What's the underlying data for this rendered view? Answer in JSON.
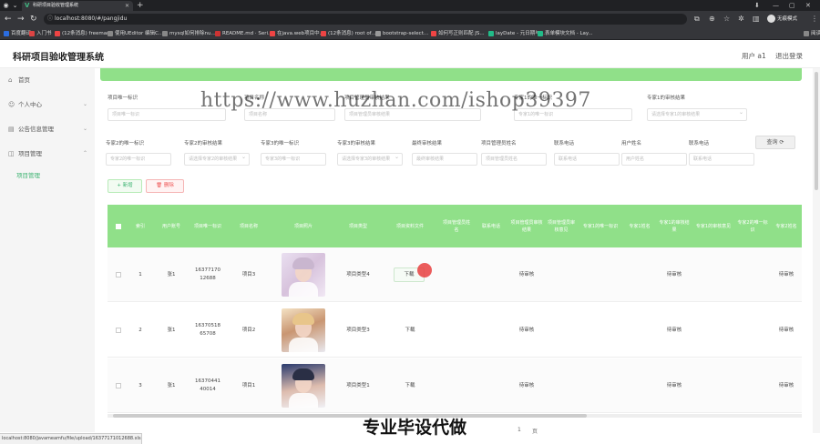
{
  "browser": {
    "tab_title": "科研项目验收管理系统",
    "address": "localhost:8080/#/pangjidu",
    "profile_label": "无痕模式",
    "bookmarks": [
      {
        "label": "百度翻译",
        "color": "#2b6de0"
      },
      {
        "label": "入门书",
        "color": "#d44"
      },
      {
        "label": "(12条消息) freemar...",
        "color": "#e44"
      },
      {
        "label": "使用UEditor 编辑C...",
        "color": "#888"
      },
      {
        "label": "mysql如何排除nu...",
        "color": "#888"
      },
      {
        "label": "README.md · Seri...",
        "color": "#c33"
      },
      {
        "label": "在java.web项目中...",
        "color": "#e44"
      },
      {
        "label": "(12条消息) root of...",
        "color": "#e44"
      },
      {
        "label": "bootstrap-select...",
        "color": "#999"
      },
      {
        "label": "如何写正则匹配 JS...",
        "color": "#e44"
      },
      {
        "label": "layDate - 元日期与...",
        "color": "#2b8"
      },
      {
        "label": "表单模块文档 - Lay...",
        "color": "#2b8"
      },
      {
        "label": "阅读清单",
        "color": "#888"
      }
    ],
    "status_url": "localhost:8080/javameamfu/file/upload/16377171012688.xls"
  },
  "app": {
    "title": "科研项目验收管理系统",
    "user_label": "用户 a1",
    "logout_label": "退出登录",
    "accent_color": "#90e089"
  },
  "sidebar": {
    "items": [
      {
        "label": "首页",
        "icon": "home-icon",
        "glyph": "⌂"
      },
      {
        "label": "个人中心",
        "icon": "user-icon",
        "glyph": "☺"
      },
      {
        "label": "公告信息管理",
        "icon": "notice-icon",
        "glyph": "▤"
      },
      {
        "label": "项目管理",
        "icon": "project-icon",
        "glyph": "◫"
      }
    ],
    "active_sub": "项目管理"
  },
  "filters": {
    "row1": [
      {
        "label": "项目唯一标识",
        "placeholder": "项目唯一标识"
      },
      {
        "label": "项目名称",
        "placeholder": "项目名称"
      },
      {
        "label": "项目管理员审核结果",
        "placeholder": "项目管理员审核结果"
      },
      {
        "label": "专家1的唯一标识",
        "placeholder": "专家1的唯一标识"
      },
      {
        "label": "专家1的审核结果",
        "placeholder": "请选择专家1的审核结果"
      }
    ],
    "row2": [
      {
        "label": "专家2的唯一标识",
        "placeholder": "专家2的唯一标识"
      },
      {
        "label": "专家2的审核结果",
        "placeholder": "请选择专家2的审核结果"
      },
      {
        "label": "专家3的唯一标识",
        "placeholder": "专家3的唯一标识"
      },
      {
        "label": "专家3的审核结果",
        "placeholder": "请选择专家3的审核结果"
      },
      {
        "label": "最终审核结果",
        "placeholder": "最终审核结果"
      },
      {
        "label": "项目管理员姓名",
        "placeholder": "项目管理员姓名"
      },
      {
        "label": "联系电话",
        "placeholder": "联系电话"
      },
      {
        "label": "用户姓名",
        "placeholder": "用户姓名"
      },
      {
        "label": "联系电话",
        "placeholder": "联系电话"
      }
    ],
    "search_label": "查询 ⟳"
  },
  "actions": {
    "add_label": "+ 新增",
    "delete_label": "🗑 删除"
  },
  "table": {
    "headers": [
      "索引",
      "用户账号",
      "项目唯一标识",
      "项目名称",
      "项目照片",
      "项目类型",
      "项目资料文件",
      "项目管理员姓名",
      "联系电话",
      "项目管理员审核结果",
      "项目管理员审核意见",
      "专家1的唯一标识",
      "专家1姓名",
      "专家1的审核结果",
      "专家1的审核意见",
      "专家2的唯一标识",
      "专家2姓名"
    ],
    "rows": [
      {
        "index": "1",
        "account": "张1",
        "uid": "1637717012688",
        "name": "项目3",
        "type": "项目类型4",
        "file": "下载",
        "review1": "待审核",
        "review2": "待审核",
        "review3": "待审核"
      },
      {
        "index": "2",
        "account": "张1",
        "uid": "1637051865708",
        "name": "项目2",
        "type": "项目类型3",
        "file": "下载",
        "review1": "待审核",
        "review2": "待审核",
        "review3": "待审核"
      },
      {
        "index": "3",
        "account": "张1",
        "uid": "1637044140014",
        "name": "项目1",
        "type": "项目类型1",
        "file": "下载",
        "review1": "待审核",
        "review2": "待审核",
        "review3": "待审核"
      }
    ]
  },
  "pager": {
    "page": "1",
    "unit": "页"
  },
  "overlays": {
    "watermark": "https://www.huzhan.com/ishop39397",
    "caption": "专业毕设代做"
  }
}
